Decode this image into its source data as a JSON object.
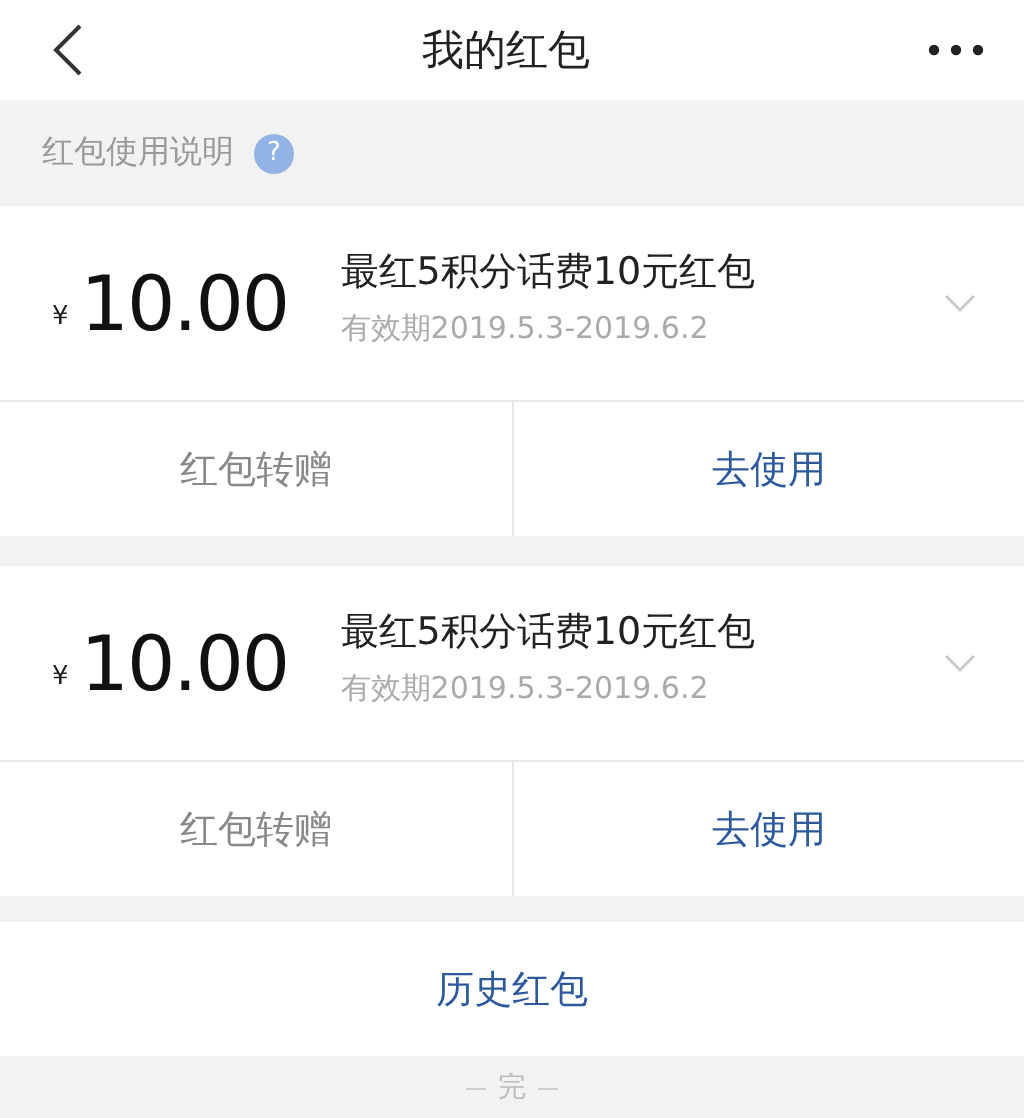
{
  "header": {
    "title": "我的红包"
  },
  "help": {
    "label": "红包使用说明",
    "icon_text": "?"
  },
  "coupons": [
    {
      "currency": "¥",
      "amount": "10.00",
      "name": "最红5积分话费10元红包",
      "validity": "有效期2019.5.3-2019.6.2",
      "expanded": false,
      "actions": [
        "红包转赠",
        "去使用"
      ]
    },
    {
      "currency": "¥",
      "amount": "10.00",
      "name": "最红5积分话费10元红包",
      "validity": "有效期2019.5.3-2019.6.2",
      "expanded": false,
      "actions": [
        "红包转赠",
        "去使用"
      ]
    }
  ],
  "history_button": "历史红包",
  "footer": "完"
}
